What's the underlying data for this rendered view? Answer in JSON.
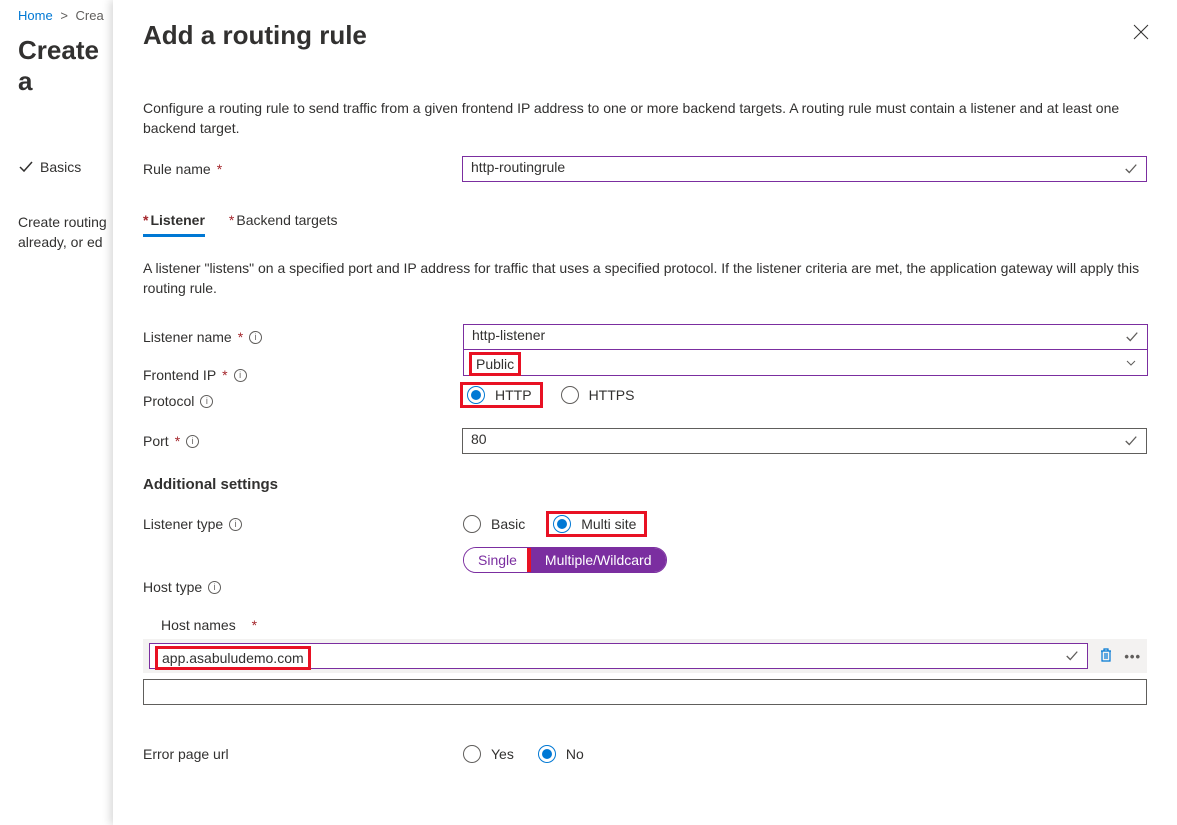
{
  "breadcrumb": {
    "home": "Home",
    "current": "Crea"
  },
  "leftTitle": "Create a",
  "step1": "Basics",
  "leftText1": "Create routing",
  "leftText2": "already, or ed",
  "panelTitle": "Add a routing rule",
  "description": "Configure a routing rule to send traffic from a given frontend IP address to one or more backend targets. A routing rule must contain a listener and at least one backend target.",
  "ruleName": {
    "label": "Rule name",
    "value": "http-routingrule"
  },
  "tabs": {
    "listener": "Listener",
    "backend": "Backend targets"
  },
  "listenerDesc": "A listener \"listens\" on a specified port and IP address for traffic that uses a specified protocol. If the listener criteria are met, the application gateway will apply this routing rule.",
  "listenerName": {
    "label": "Listener name",
    "value": "http-listener"
  },
  "frontendIp": {
    "label": "Frontend IP",
    "value": "Public"
  },
  "protocol": {
    "label": "Protocol",
    "http": "HTTP",
    "https": "HTTPS"
  },
  "port": {
    "label": "Port",
    "value": "80"
  },
  "additional": "Additional settings",
  "listenerType": {
    "label": "Listener type",
    "basic": "Basic",
    "multi": "Multi site"
  },
  "hostType": {
    "label": "Host type",
    "single": "Single",
    "multiple": "Multiple/Wildcard"
  },
  "hostNames": {
    "label": "Host names",
    "value": "app.asabuludemo.com"
  },
  "errorPage": {
    "label": "Error page url",
    "yes": "Yes",
    "no": "No"
  }
}
